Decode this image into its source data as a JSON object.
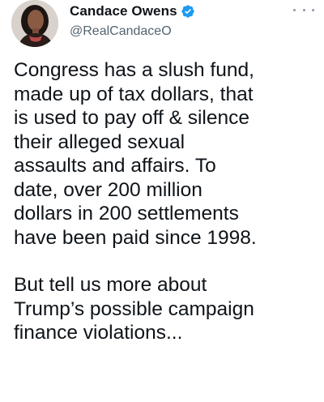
{
  "author": {
    "display_name": "Candace Owens",
    "handle": "@RealCandaceO",
    "avatar_icon": "profile-photo",
    "verified_icon": "verified-badge-icon",
    "verified_color": "#1d9bf0"
  },
  "menu": {
    "icon": "more-options-icon"
  },
  "tweet": {
    "paragraph_1": [
      "Congress has a slush fund,",
      "made up of tax dollars, that",
      "is used to pay off & silence",
      "their alleged sexual",
      "assaults and affairs. To",
      "date, over 200 million",
      "dollars in 200 settlements",
      "have been paid since 1998."
    ],
    "paragraph_2": [
      "But tell us more about",
      "Trump’s possible campaign",
      "finance violations..."
    ]
  }
}
